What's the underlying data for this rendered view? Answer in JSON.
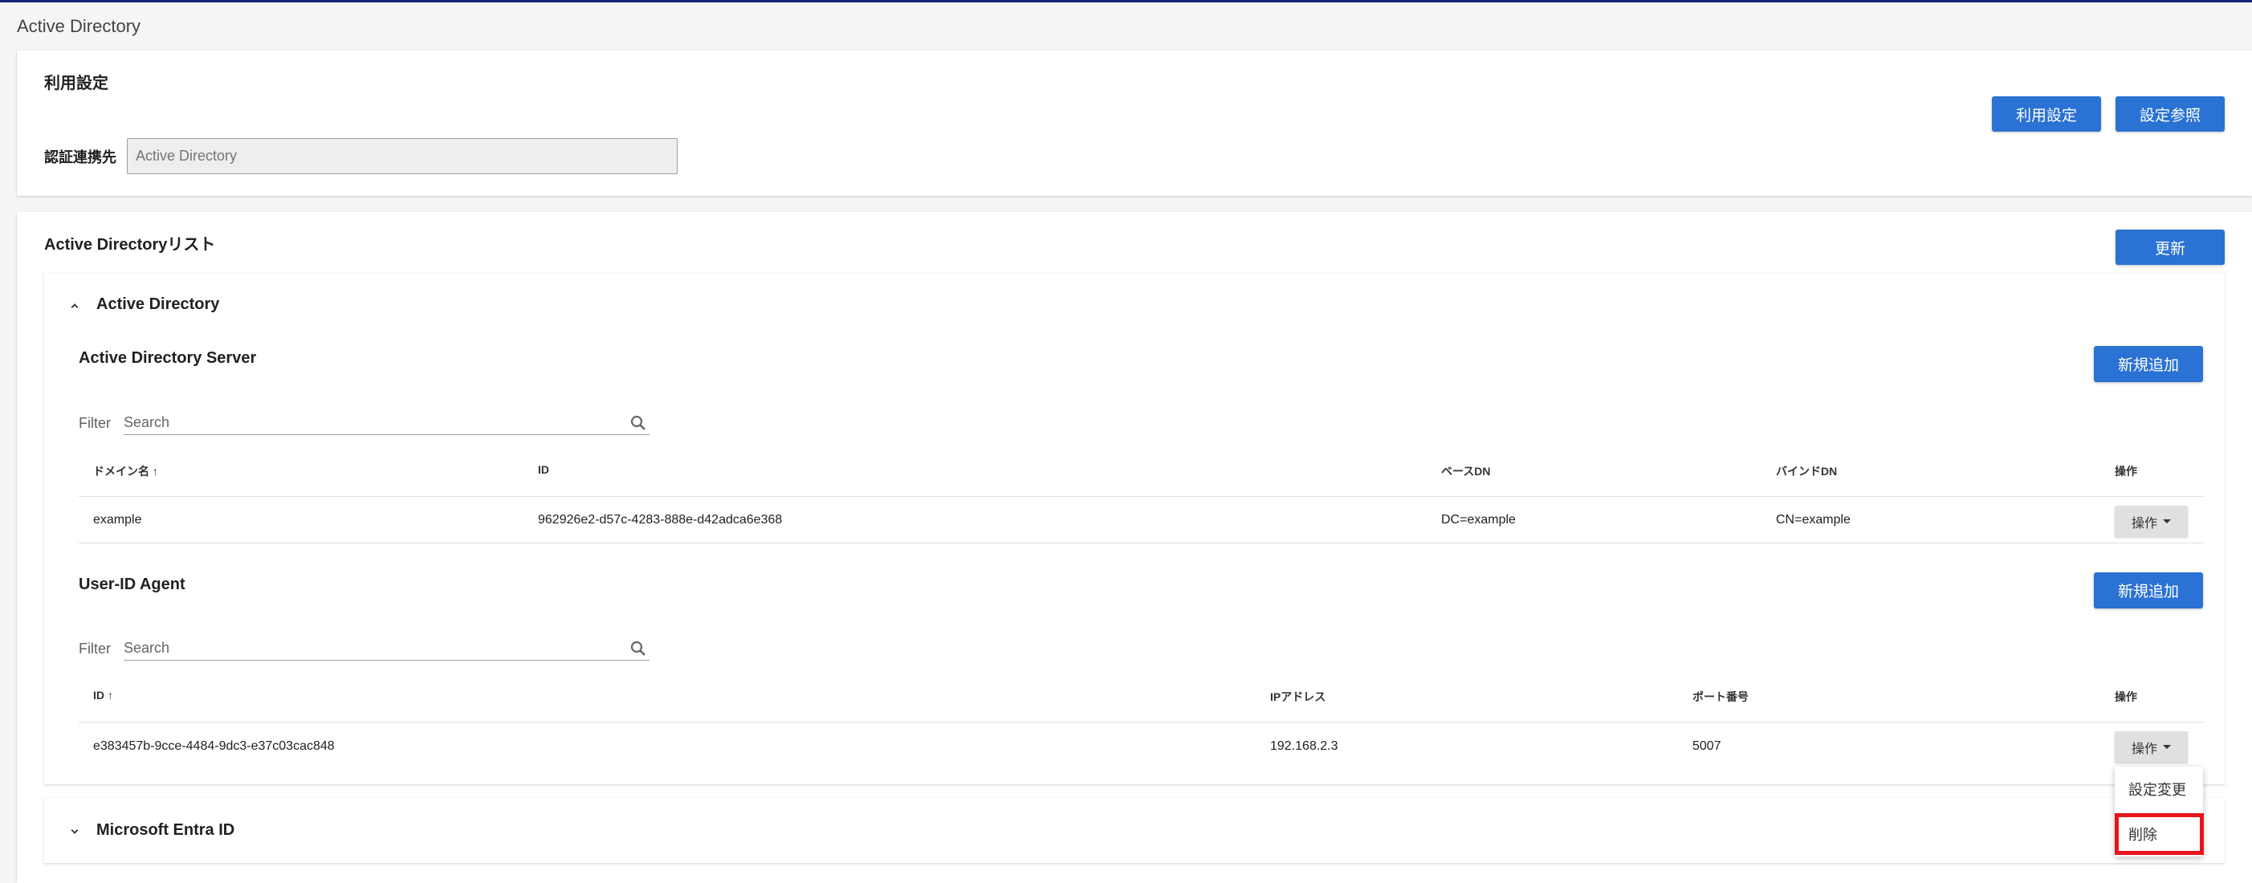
{
  "page": {
    "title": "Active Directory"
  },
  "usage": {
    "title": "利用設定",
    "auth_label": "認証連携先",
    "auth_value": "Active Directory",
    "usage_button": "利用設定",
    "view_button": "設定参照"
  },
  "ad_list": {
    "title": "Active Directoryリスト",
    "refresh_button": "更新",
    "ad_panel": {
      "title": "Active Directory",
      "server": {
        "title": "Active Directory Server",
        "add_button": "新規追加",
        "filter_label": "Filter",
        "search_placeholder": "Search",
        "columns": [
          "ドメイン名 ↑",
          "ID",
          "ベースDN",
          "バインドDN",
          "操作"
        ],
        "rows": [
          {
            "domain": "example",
            "id": "962926e2-d57c-4283-888e-d42adca6e368",
            "base_dn": "DC=example",
            "bind_dn": "CN=example",
            "op": "操作"
          }
        ]
      },
      "agent": {
        "title": "User-ID Agent",
        "add_button": "新規追加",
        "filter_label": "Filter",
        "search_placeholder": "Search",
        "columns": [
          "ID ↑",
          "IPアドレス",
          "ポート番号",
          "操作"
        ],
        "rows": [
          {
            "id": "e383457b-9cce-4484-9dc3-e37c03cac848",
            "ip": "192.168.2.3",
            "port": "5007",
            "op": "操作"
          }
        ]
      }
    },
    "entra_panel": {
      "title": "Microsoft Entra ID"
    }
  },
  "menu": {
    "items": [
      "設定変更",
      "削除"
    ]
  },
  "colors": {
    "primary": "#2a72d3",
    "highlight": "#e8141c",
    "topbar": "#1a237e"
  }
}
